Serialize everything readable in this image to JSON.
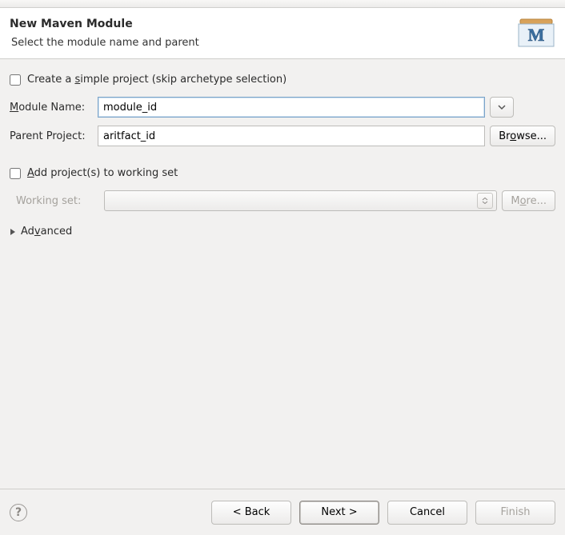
{
  "header": {
    "title": "New Maven Module",
    "subtitle": "Select the module name and parent"
  },
  "simpleProject": {
    "checked": false,
    "label_pre": "Create a ",
    "label_u": "s",
    "label_post": "imple project (skip archetype selection)"
  },
  "moduleName": {
    "label_u": "M",
    "label_post": "odule Name:",
    "value": "module_id"
  },
  "parentProject": {
    "label": "Parent Project:",
    "value": "aritfact_id",
    "browse_pre": "Br",
    "browse_u": "o",
    "browse_post": "wse..."
  },
  "workingSet": {
    "add_checked": false,
    "add_u": "A",
    "add_post": "dd project(s) to working set",
    "label": "Working set:",
    "more_pre": "M",
    "more_u": "o",
    "more_post": "re..."
  },
  "advanced": {
    "label_pre": "Ad",
    "label_u": "v",
    "label_post": "anced"
  },
  "buttons": {
    "back": "< Back",
    "next": "Next >",
    "cancel": "Cancel",
    "finish": "Finish"
  }
}
